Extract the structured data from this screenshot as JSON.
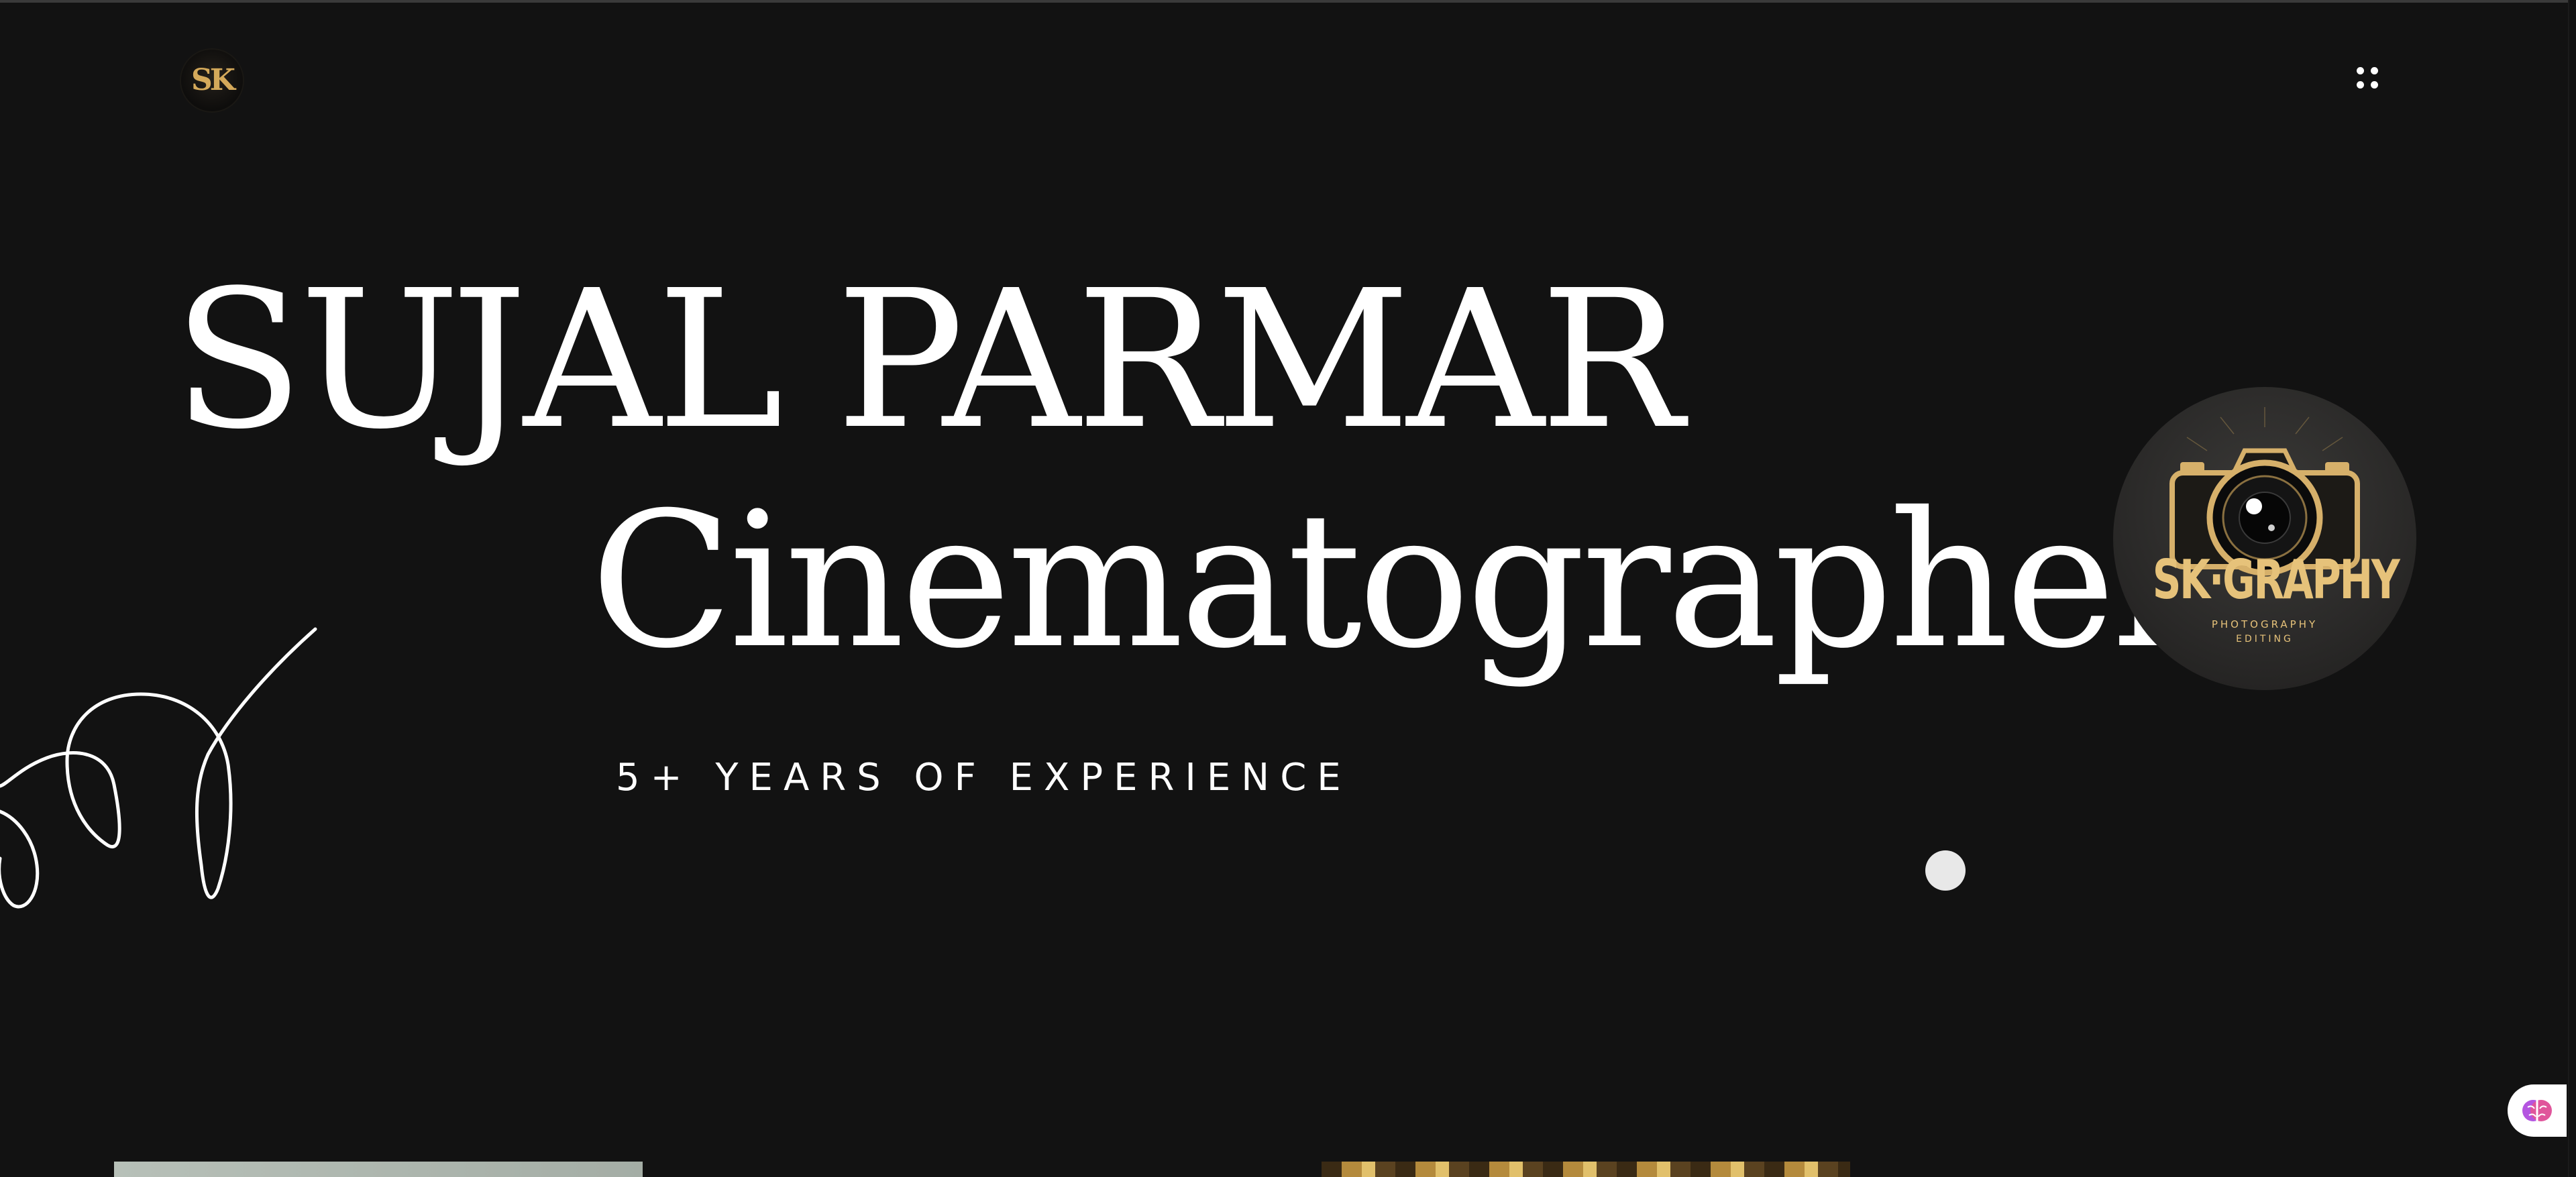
{
  "logo": {
    "text": "SK"
  },
  "hero": {
    "name": "SUJAL PARMAR",
    "role": "Cinematographer",
    "experience": "5+ YEARS OF EXPERIENCE"
  },
  "badge": {
    "title": "SK·GRAPHY",
    "subtitle": "PHOTOGRAPHY",
    "subtitle2": "EDITING"
  },
  "icons": {
    "menu": "grid-dots-icon",
    "extension": "brain-icon"
  },
  "colors": {
    "background": "#121212",
    "text": "#ffffff",
    "gold": "#d4a95a"
  }
}
